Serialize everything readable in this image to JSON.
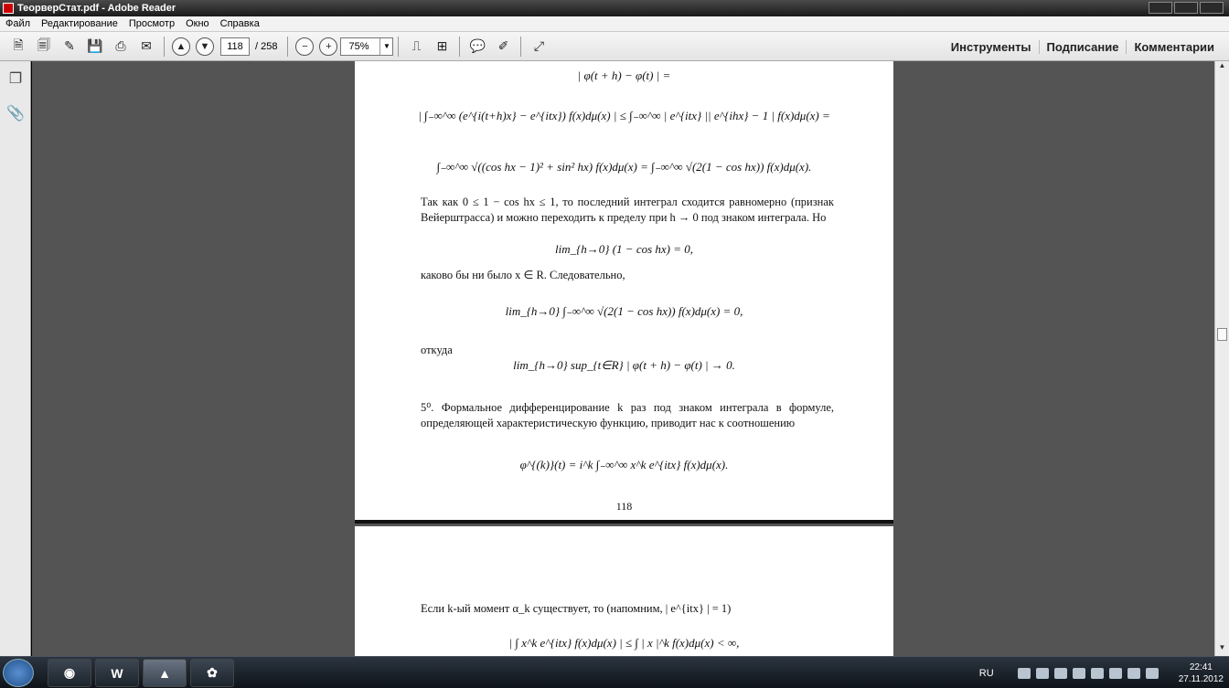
{
  "window": {
    "title": "ТеорверСтат.pdf - Adobe Reader"
  },
  "menu": [
    "Файл",
    "Редактирование",
    "Просмотр",
    "Окно",
    "Справка"
  ],
  "toolbar": {
    "page_current": "118",
    "page_total": "/ 258",
    "zoom": "75%",
    "tools_label": "Инструменты",
    "sign_label": "Подписание",
    "comments_label": "Комментарии"
  },
  "page1": {
    "lines": [
      {
        "type": "eq",
        "text": "| φ(t + h) − φ(t) | ="
      },
      {
        "type": "eq",
        "text": "| ∫₋∞^∞ (e^{i(t+h)x} − e^{itx}) f(x)dμ(x) | ≤ ∫₋∞^∞ | e^{itx} || e^{ihx} − 1 | f(x)dμ(x) ="
      },
      {
        "type": "eq",
        "text": "∫₋∞^∞ √((cos hx − 1)² + sin² hx) f(x)dμ(x) = ∫₋∞^∞ √(2(1 − cos hx)) f(x)dμ(x)."
      },
      {
        "type": "text",
        "text": "Так как 0 ≤ 1 − cos hx ≤ 1, то последний интеграл сходится равномерно (признак Вейерштрасса) и можно переходить к пределу при h → 0 под знаком интеграла. Но"
      },
      {
        "type": "eq",
        "text": "lim_{h→0} (1 − cos hx) = 0,"
      },
      {
        "type": "text",
        "text": "каково бы ни было x ∈ R. Следовательно,"
      },
      {
        "type": "eq",
        "text": "lim_{h→0} ∫₋∞^∞ √(2(1 − cos hx)) f(x)dμ(x) = 0,"
      },
      {
        "type": "text",
        "text": "откуда"
      },
      {
        "type": "eq",
        "text": "lim_{h→0} sup_{t∈R} | φ(t + h) − φ(t) | → 0."
      },
      {
        "type": "text",
        "text": "5⁰. Формальное дифференцирование k раз под знаком интеграла в формуле, определяющей характеристическую функцию, приводит нас к соотношению"
      },
      {
        "type": "eq",
        "text": "φ^{(k)}(t) = i^k ∫₋∞^∞ x^k e^{itx} f(x)dμ(x)."
      }
    ],
    "page_number": "118"
  },
  "page2": {
    "lines": [
      {
        "type": "text",
        "text": "Если k-ый момент α_k существует, то (напомним, | e^{itx} | = 1)"
      },
      {
        "type": "eq",
        "text": "| ∫ x^k e^{itx} f(x)dμ(x) | ≤ ∫ | x |^k f(x)dμ(x) < ∞,"
      }
    ]
  },
  "taskbar": {
    "lang": "RU",
    "time": "22:41",
    "date": "27.11.2012"
  }
}
